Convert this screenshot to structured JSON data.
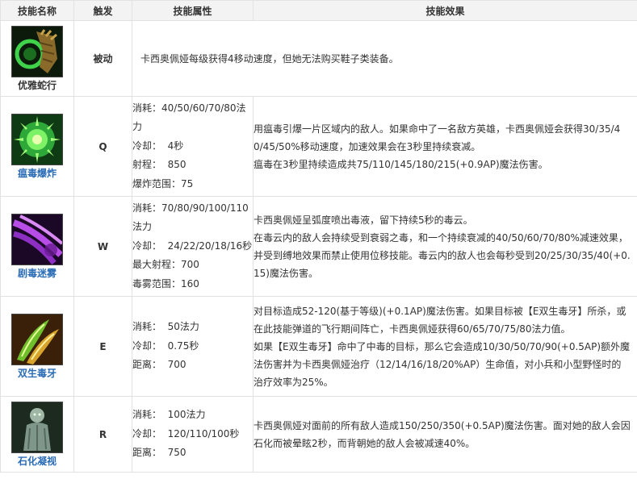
{
  "headers": {
    "name": "技能名称",
    "trigger": "触发",
    "attributes": "技能属性",
    "effect": "技能效果"
  },
  "skills": [
    {
      "name": "优雅蛇行",
      "icon": "serpentine-claw-icon",
      "trigger": "被动",
      "attributes": [],
      "effect": [
        "卡西奥佩娅每级获得4移动速度，但她无法购买鞋子类装备。"
      ]
    },
    {
      "name": "瘟毒爆炸",
      "icon": "noxious-blast-icon",
      "trigger": "Q",
      "attributes": [
        "消耗：40/50/60/70/80法",
        "力",
        "冷却：  4秒",
        "射程：  850",
        "爆炸范围：75"
      ],
      "effect": [
        "用瘟毒引爆一片区域内的敌人。如果命中了一名敌方英雄，卡西奥佩娅会获得30/35/4",
        "0/45/50%移动速度，加速效果会在3秒里持续衰减。",
        "瘟毒在3秒里持续造成共75/110/145/180/215(+0.9AP)魔法伤害。"
      ]
    },
    {
      "name": "剧毒迷雾",
      "icon": "miasma-icon",
      "trigger": "W",
      "attributes": [
        "消耗：70/80/90/100/110",
        "法力",
        "冷却：  24/22/20/18/16秒",
        "最大射程：700",
        "毒雾范围：160"
      ],
      "effect": [
        "卡西奥佩娅呈弧度喷出毒液，留下持续5秒的毒云。",
        "在毒云内的敌人会持续受到衰弱之毒，和一个持续衰减的40/50/60/70/80%减速效果，",
        "并受到缚地效果而禁止使用位移技能。毒云内的敌人也会每秒受到20/25/30/35/40(+0.",
        "15)魔法伤害。"
      ]
    },
    {
      "name": "双生毒牙",
      "icon": "twin-fang-icon",
      "trigger": "E",
      "attributes": [
        "消耗：  50法力",
        "冷却：  0.75秒",
        "距离：  700"
      ],
      "effect": [
        "对目标造成52-120(基于等级)(+0.1AP)魔法伤害。如果目标被【E双生毒牙】所杀，或",
        "在此技能弹道的飞行期间阵亡，卡西奥佩娅获得60/65/70/75/80法力值。",
        "如果【E双生毒牙】命中了中毒的目标，那么它会造成10/30/50/70/90(+0.5AP)额外魔",
        "法伤害并为卡西奥佩娅治疗（12/14/16/18/20%AP）生命值，对小兵和小型野怪时的",
        "治疗效率为25%。"
      ]
    },
    {
      "name": "石化凝视",
      "icon": "petrifying-gaze-icon",
      "trigger": "R",
      "attributes": [
        "消耗：  100法力",
        "冷却：  120/110/100秒",
        "距离：  750"
      ],
      "effect": [
        "卡西奥佩娅对面前的所有敌人造成150/250/350(+0.5AP)魔法伤害。面对她的敌人会因",
        "石化而被晕眩2秒，而背朝她的敌人会被减速40%。"
      ]
    }
  ]
}
